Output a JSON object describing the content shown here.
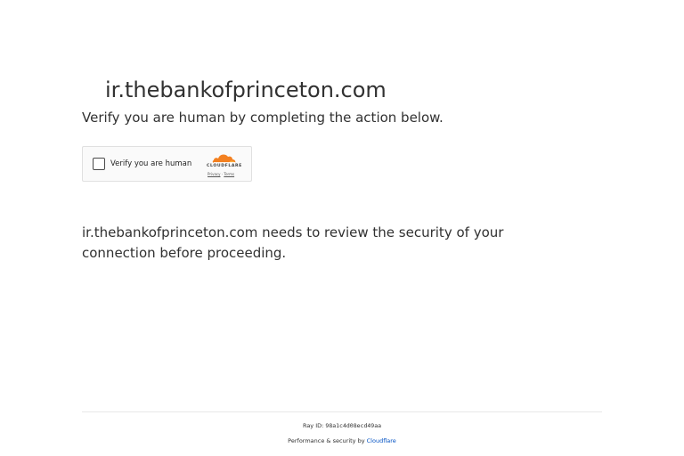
{
  "header": {
    "site_title": "ir.thebankofprinceton.com",
    "subtitle": "Verify you are human by completing the action below."
  },
  "challenge_widget": {
    "checkbox_label": "Verify you are human",
    "brand_wordmark": "CLOUDFLARE",
    "privacy_link": "Privacy",
    "link_separator": "·",
    "terms_link": "Terms",
    "brand_colors": {
      "cloud_primary": "#f38020",
      "cloud_secondary": "#faae40"
    }
  },
  "main": {
    "message": "ir.thebankofprinceton.com needs to review the security of your connection before proceeding."
  },
  "footer": {
    "ray_id_label": "Ray ID: ",
    "ray_id_value": "98a1c4d08ecd49aa",
    "performance_text": "Performance & security by ",
    "performance_link": "Cloudflare",
    "link_color": "#0051c3"
  }
}
